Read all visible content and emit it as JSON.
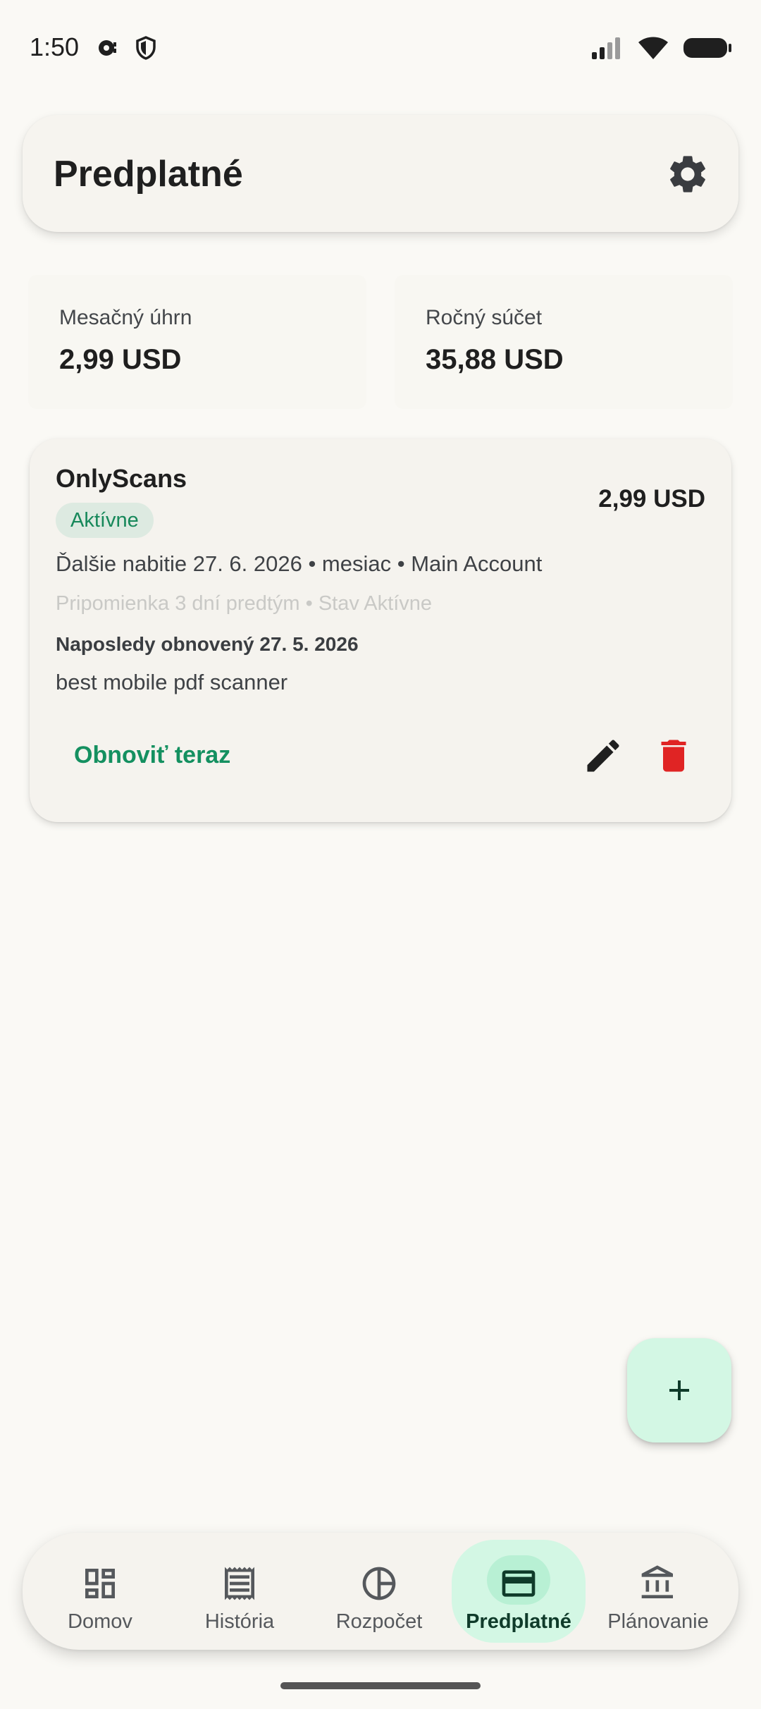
{
  "status_bar": {
    "time": "1:50"
  },
  "header": {
    "title": "Predplatné"
  },
  "summary": {
    "monthly_label": "Mesačný úhrn",
    "monthly_value": "2,99 USD",
    "yearly_label": "Ročný súčet",
    "yearly_value": "35,88 USD"
  },
  "subscription": {
    "name": "OnlyScans",
    "price": "2,99 USD",
    "status_badge": "Aktívne",
    "next_charge": "Ďalšie nabitie 27. 6. 2026 • mesiac • Main Account",
    "reminder": "Pripomienka 3 dní predtým • Stav Aktívne",
    "last_renewed": "Naposledy obnovený 27. 5. 2026",
    "note": "best mobile pdf scanner",
    "renew_label": "Obnoviť teraz"
  },
  "nav": {
    "items": [
      {
        "label": "Domov",
        "icon": "dashboard-icon"
      },
      {
        "label": "História",
        "icon": "receipt-icon"
      },
      {
        "label": "Rozpočet",
        "icon": "pie-chart-icon"
      },
      {
        "label": "Predplatné",
        "icon": "credit-card-icon",
        "active": true
      },
      {
        "label": "Plánovanie",
        "icon": "bank-icon"
      }
    ]
  },
  "colors": {
    "accent_green": "#149060",
    "badge_bg": "#DDEAE1",
    "fab_bg": "#D3F7E4",
    "delete_red": "#E02424",
    "background": "#FAF9F5"
  }
}
